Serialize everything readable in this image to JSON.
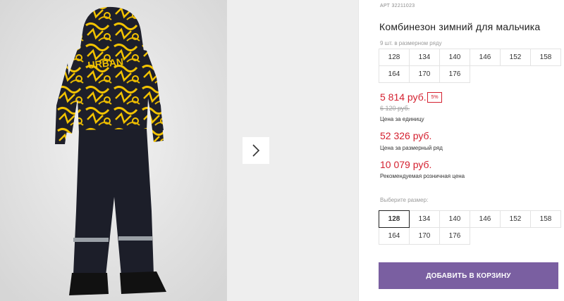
{
  "gallery": {
    "photo_alt": "product-photo",
    "next_arrow": "chevron-right-icon"
  },
  "product": {
    "article_label": "АРТ",
    "article_value": "32211023",
    "title": "Комбинезон зимний для мальчика"
  },
  "pack": {
    "label": "9 шт. в размерном ряду",
    "sizes": [
      "128",
      "134",
      "140",
      "146",
      "152",
      "158",
      "164",
      "170",
      "176"
    ]
  },
  "pricing": {
    "price": "5 814 руб.",
    "discount_badge": "5%",
    "old_price": "6 120 руб.",
    "unit_note": "Цена за единицу",
    "pack_price": "52 326 руб.",
    "pack_note": "Цена за размерный ряд",
    "retail_price": "10 079 руб.",
    "retail_note": "Рекомендуемая розничная цена"
  },
  "size_select": {
    "label": "Выберите размер:",
    "sizes": [
      "128",
      "134",
      "140",
      "146",
      "152",
      "158",
      "164",
      "170",
      "176"
    ],
    "selected": "128"
  },
  "cart": {
    "button_label": "ДОБАВИТЬ В КОРЗИНУ"
  },
  "colors": {
    "accent_red": "#d4202f",
    "button_purple": "#7a5fa1"
  }
}
